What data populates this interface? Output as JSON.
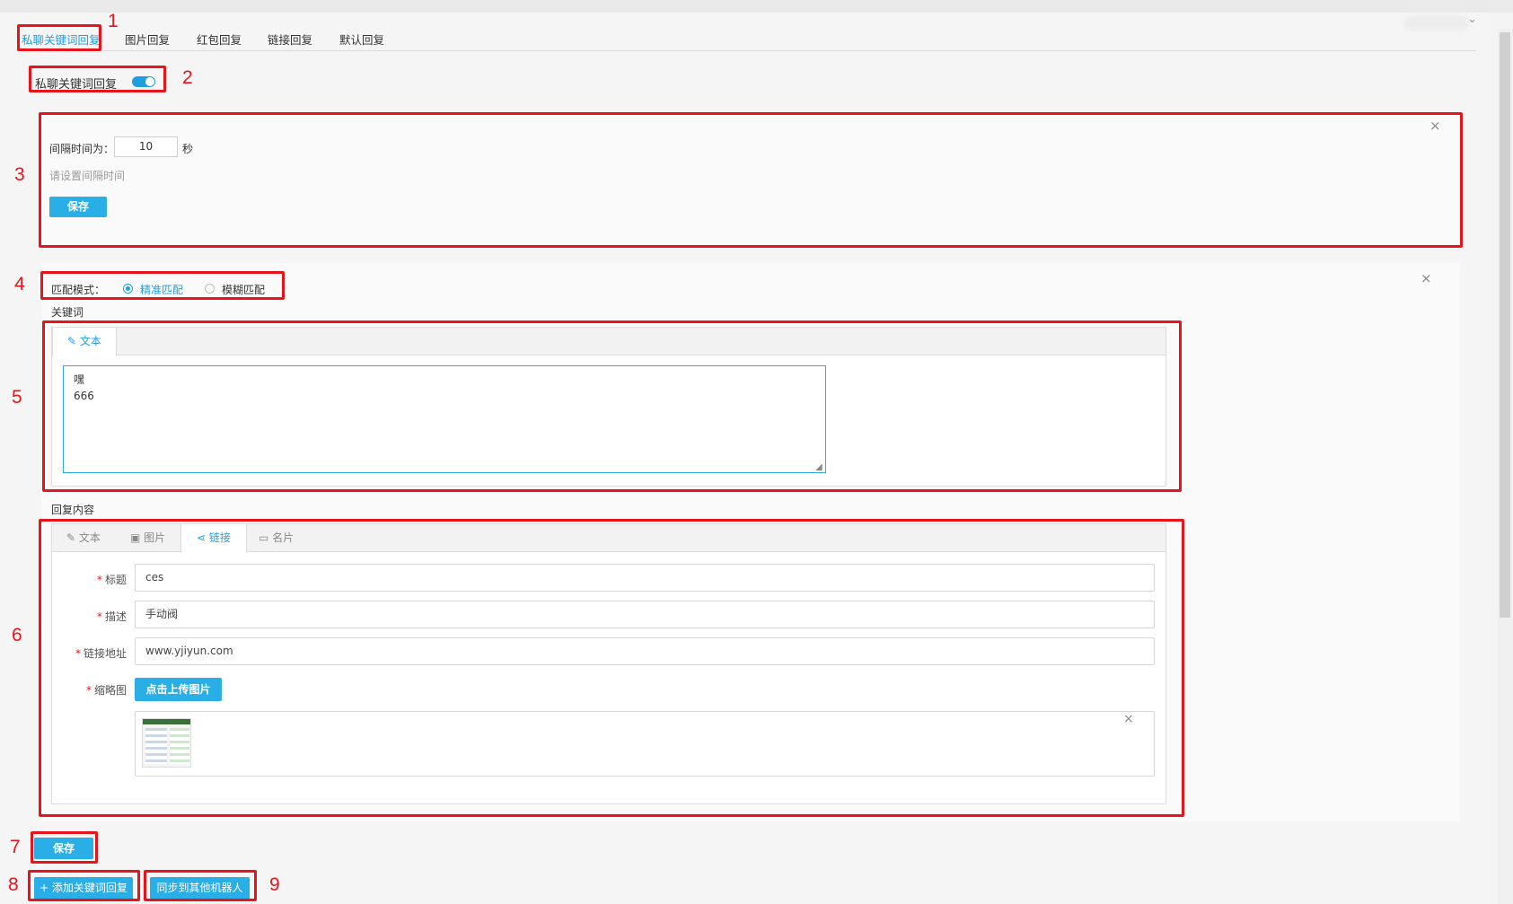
{
  "tabs": [
    {
      "label": "私聊关键词回复",
      "active": true
    },
    {
      "label": "图片回复",
      "active": false
    },
    {
      "label": "红包回复",
      "active": false
    },
    {
      "label": "链接回复",
      "active": false
    },
    {
      "label": "默认回复",
      "active": false
    }
  ],
  "toggle": {
    "label": "私聊关键词回复",
    "on": true
  },
  "interval": {
    "label": "间隔时间为：",
    "value": "10",
    "unit": "秒",
    "hint": "请设置间隔时间",
    "save_label": "保存"
  },
  "match_mode": {
    "label": "匹配模式：",
    "options": [
      {
        "label": "精准匹配",
        "selected": true
      },
      {
        "label": "模糊匹配",
        "selected": false
      }
    ]
  },
  "keyword": {
    "section_label": "关键词",
    "tab_label": "文本",
    "text": "嘿\n666"
  },
  "reply": {
    "section_label": "回复内容",
    "tabs": [
      {
        "label": "文本",
        "icon": "pencil-icon",
        "active": false
      },
      {
        "label": "图片",
        "icon": "image-icon",
        "active": false
      },
      {
        "label": "链接",
        "icon": "share-icon",
        "active": true
      },
      {
        "label": "名片",
        "icon": "card-icon",
        "active": false
      }
    ],
    "fields": {
      "title_label": "标题",
      "title_value": "ces",
      "desc_label": "描述",
      "desc_value": "手动阀",
      "url_label": "链接地址",
      "url_value": "www.yjiyun.com",
      "thumb_label": "缩略图",
      "upload_label": "点击上传图片"
    }
  },
  "bottom": {
    "save_label": "保存",
    "add_label": "+ 添加关键词回复",
    "sync_label": "同步到其他机器人"
  },
  "annotations": [
    "1",
    "2",
    "3",
    "4",
    "5",
    "6",
    "7",
    "8",
    "9"
  ],
  "colors": {
    "accent": "#1e9fe0",
    "button": "#29aee6",
    "annotation": "#e8141b"
  }
}
